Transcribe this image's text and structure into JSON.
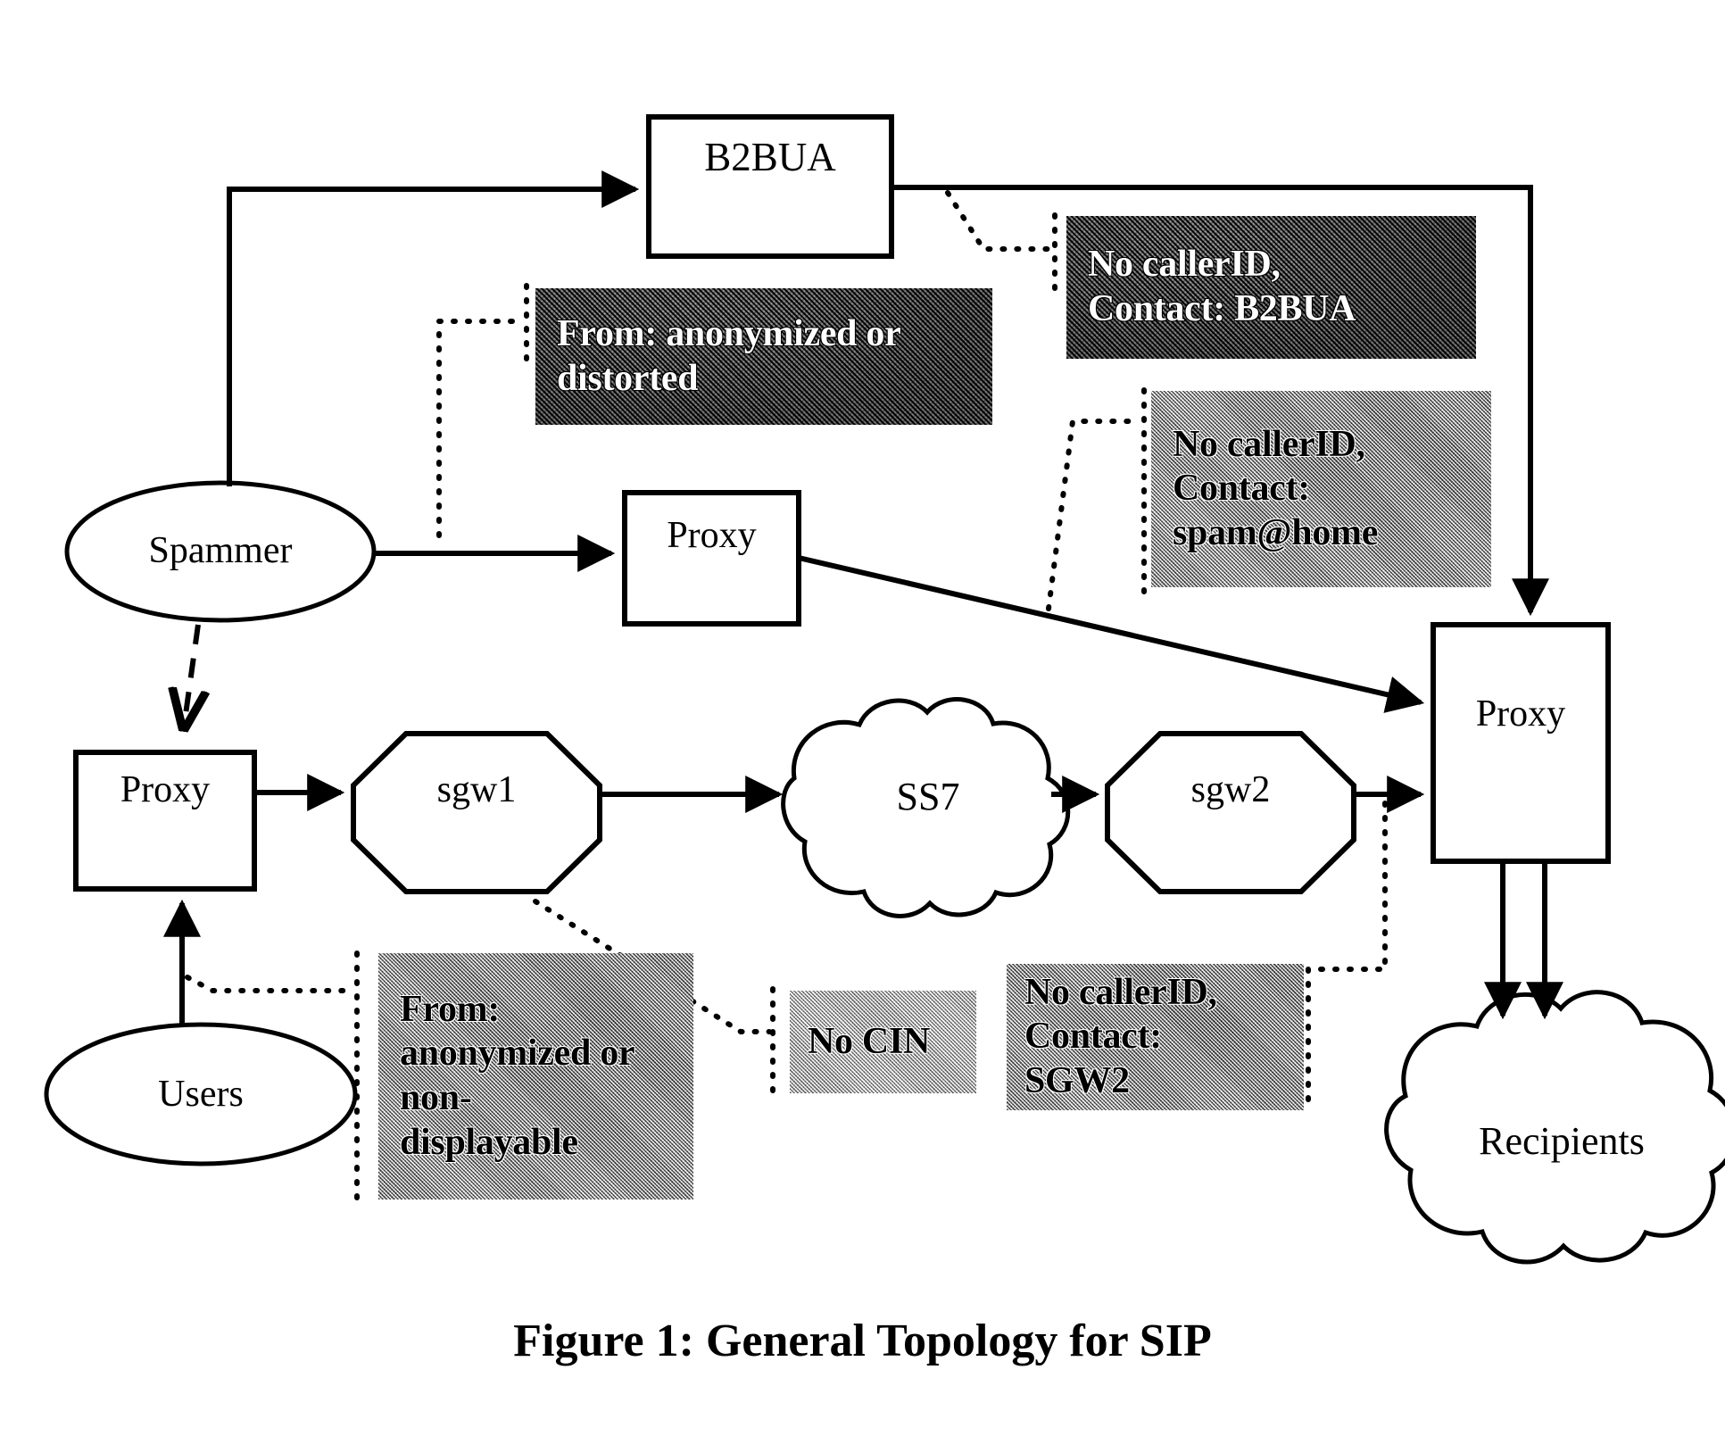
{
  "figure": {
    "caption": "Figure 1: General Topology for SIP"
  },
  "nodes": {
    "b2bua": {
      "label": "B2BUA",
      "shape": "rect"
    },
    "spammer": {
      "label": "Spammer",
      "shape": "ellipse"
    },
    "proxy_mid": {
      "label": "Proxy",
      "shape": "rect"
    },
    "proxy_left": {
      "label": "Proxy",
      "shape": "rect"
    },
    "proxy_right": {
      "label": "Proxy",
      "shape": "rect"
    },
    "sgw1": {
      "label": "sgw1",
      "shape": "octagon"
    },
    "ss7": {
      "label": "SS7",
      "shape": "cloud"
    },
    "sgw2": {
      "label": "sgw2",
      "shape": "octagon"
    },
    "users": {
      "label": "Users",
      "shape": "ellipse"
    },
    "recipients": {
      "label": "Recipients",
      "shape": "cloud"
    }
  },
  "callouts": {
    "b2bua_contact": {
      "lines": [
        "No callerID,",
        "Contact: B2BUA"
      ],
      "tone": "dark"
    },
    "from_distorted": {
      "lines": [
        "From: anonymized or",
        "distorted"
      ],
      "tone": "dark"
    },
    "spam_home": {
      "lines": [
        "No callerID,",
        "Contact:",
        "spam@home"
      ],
      "tone": "mid"
    },
    "from_nondisplayable": {
      "lines": [
        "From:",
        "anonymized or",
        "non-",
        "displayable"
      ],
      "tone": "mid"
    },
    "no_cin": {
      "lines": [
        "No CIN"
      ],
      "tone": "light"
    },
    "sgw2_contact": {
      "lines": [
        "No callerID,",
        "Contact:",
        "SGW2"
      ],
      "tone": "mid"
    }
  },
  "colors": {
    "stroke": "#000000",
    "fill": "#ffffff",
    "background": "#ffffff"
  }
}
